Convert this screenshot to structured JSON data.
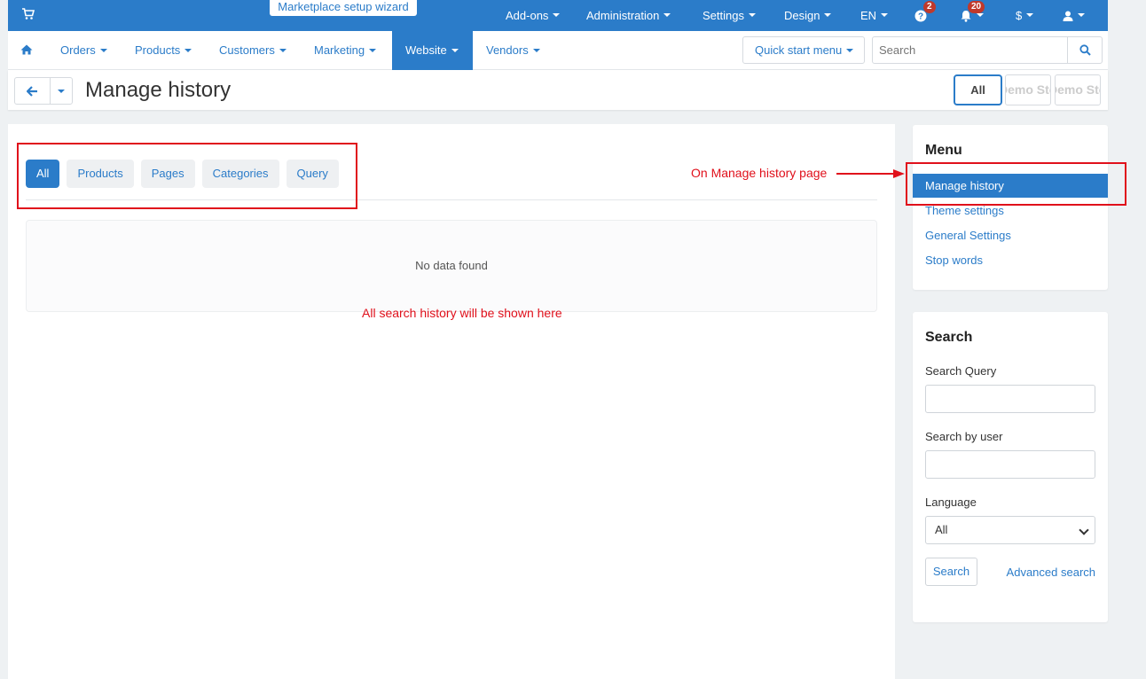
{
  "topbar": {
    "wizard_label": "Marketplace setup wizard",
    "items": [
      {
        "label": "Add-ons"
      },
      {
        "label": "Administration"
      },
      {
        "label": "Settings"
      },
      {
        "label": "Design"
      },
      {
        "label": "EN"
      }
    ],
    "help_badge": "2",
    "notifications_badge": "20",
    "currency_label": "$"
  },
  "nav": {
    "items": [
      {
        "label": "Orders"
      },
      {
        "label": "Products"
      },
      {
        "label": "Customers"
      },
      {
        "label": "Marketing"
      },
      {
        "label": "Website"
      },
      {
        "label": "Vendors"
      }
    ],
    "quick_start_label": "Quick start menu",
    "search_placeholder": "Search"
  },
  "title_bar": {
    "page_title": "Manage history",
    "store_all_label": "All",
    "store_1_label": "Demo Store",
    "store_2_label": "Demo Store"
  },
  "main": {
    "tabs": [
      {
        "label": "All"
      },
      {
        "label": "Products"
      },
      {
        "label": "Pages"
      },
      {
        "label": "Categories"
      },
      {
        "label": "Query"
      }
    ],
    "no_data_text": "No data found"
  },
  "annotations": {
    "arrow_note": "On Manage history page",
    "history_note": "All search history will be shown here",
    "color": "#e0101b"
  },
  "sidebar": {
    "menu_title": "Menu",
    "menu_items": [
      {
        "label": "Manage history"
      },
      {
        "label": "Theme settings"
      },
      {
        "label": "General Settings"
      },
      {
        "label": "Stop words"
      }
    ],
    "search_title": "Search",
    "search_query_label": "Search Query",
    "search_user_label": "Search by user",
    "language_label": "Language",
    "language_value": "All",
    "search_button": "Search",
    "advanced_search": "Advanced search"
  },
  "colors": {
    "primary": "#2b7cc9",
    "badge": "#c0392b"
  }
}
